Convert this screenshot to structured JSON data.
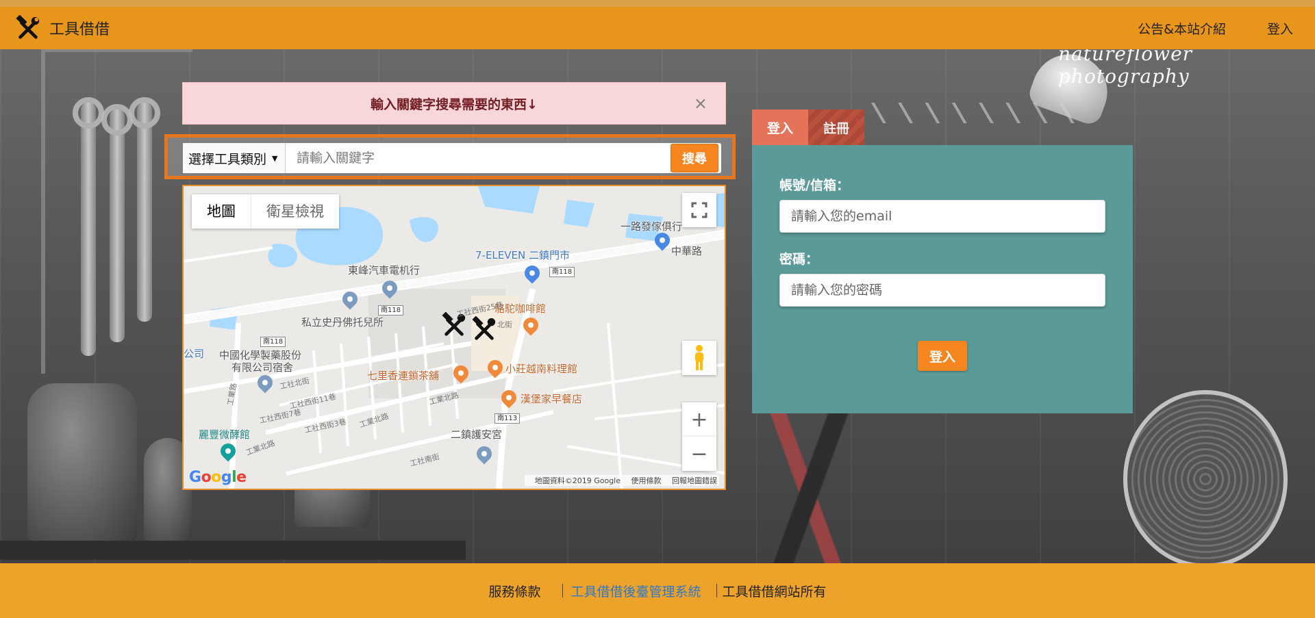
{
  "header": {
    "brand": "工具借借",
    "nav": {
      "announcements": "公告&本站介紹",
      "login": "登入"
    },
    "colors": {
      "header_bg": "#e8961b"
    }
  },
  "background": {
    "watermark": "natureflower photography"
  },
  "alert": {
    "message": "輸入關鍵字搜尋需要的東西↓",
    "close": "×"
  },
  "search": {
    "category_label": "選擇工具類別",
    "keyword_placeholder": "請輸入關鍵字",
    "button": "搜尋"
  },
  "map": {
    "type_map": "地圖",
    "type_satellite": "衛星檢視",
    "places": {
      "p1": "一路發傢俱行",
      "p2": "7-ELEVEN 二鎮門市",
      "p3": "東峰汽車電机行",
      "p4": "私立史丹佛托兒所",
      "p5": "駱駝咖啡館",
      "p6": "中國化學製藥股份",
      "p6b": "有限公司宿舍",
      "p7": "七里香連鎖茶舖",
      "p8": "小莊越南料理館",
      "p9": "漢堡家早餐店",
      "p10": "二鎮護安宮",
      "p11": "麗豐微酵館",
      "p12": "公司",
      "p13": "中華路"
    },
    "roads": {
      "r1": "南118",
      "r2": "南118",
      "r3": "南118",
      "r4": "南113",
      "s1": "工社西街25巷",
      "s2": "工社北街",
      "s3": "工社西街11巷",
      "s4": "工社西街7巷",
      "s5": "工社西街3巷",
      "s6": "工業北路",
      "s7": "工業路",
      "s8": "工業北路",
      "s9": "工社南街",
      "s10": "北街",
      "s11": "工業北路"
    },
    "google_logo": "Google",
    "attribution": {
      "data": "地圖資料©2019 Google",
      "terms": "使用條款",
      "report": "回報地圖錯誤"
    },
    "zoom_in": "+",
    "zoom_out": "−",
    "fullscreen_icon": "fullscreen-icon",
    "pegman_icon": "pegman-icon",
    "tool_marker_icon": "hammer-wrench-icon"
  },
  "auth": {
    "tab_login": "登入",
    "tab_register": "註冊",
    "account_label": "帳號/信箱：",
    "account_placeholder": "請輸入您的email",
    "password_label": "密碼：",
    "password_placeholder": "請輸入您的密碼",
    "submit": "登入",
    "colors": {
      "panel_bg": "#5a9a99",
      "button": "#f5851f"
    }
  },
  "footer": {
    "terms": "服務條款",
    "admin": "工具借借後臺管理系統",
    "copyright": "工具借借網站所有"
  }
}
